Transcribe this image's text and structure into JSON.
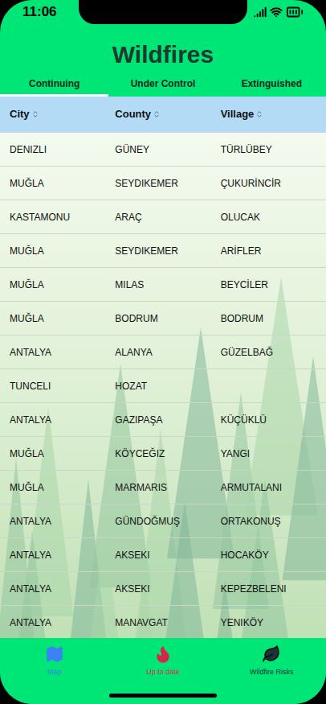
{
  "status_bar": {
    "time": "11:06"
  },
  "title": "Wildfires",
  "tabs": [
    {
      "label": "Continuing",
      "selected": true
    },
    {
      "label": "Under Control",
      "selected": false
    },
    {
      "label": "Extinguished",
      "selected": false
    }
  ],
  "table": {
    "columns": [
      {
        "label": "City"
      },
      {
        "label": "County"
      },
      {
        "label": "Village"
      }
    ],
    "rows": [
      [
        "DENIZLI",
        "GÜNEY",
        "TÜRLÜBEY"
      ],
      [
        "MUĞLA",
        "SEYDIKEMER",
        "ÇUKURİNCİR"
      ],
      [
        "KASTAMONU",
        "ARAÇ",
        "OLUCAK"
      ],
      [
        "MUĞLA",
        "SEYDIKEMER",
        "ARİFLER"
      ],
      [
        "MUĞLA",
        "MILAS",
        "BEYCİLER"
      ],
      [
        "MUĞLA",
        "BODRUM",
        "BODRUM"
      ],
      [
        "ANTALYA",
        "ALANYA",
        "GÜZELBAĞ"
      ],
      [
        "TUNCELI",
        "HOZAT",
        ""
      ],
      [
        "ANTALYA",
        "GAZIPAŞA",
        "KÜÇÜKLÜ"
      ],
      [
        "MUĞLA",
        "KÖYCEĞIZ",
        "YANGI"
      ],
      [
        "MUĞLA",
        "MARMARIS",
        "ARMUTALANI"
      ],
      [
        "ANTALYA",
        "GÜNDOĞMUŞ",
        "ORTAKONUŞ"
      ],
      [
        "ANTALYA",
        "AKSEKI",
        "HOCAKÖY"
      ],
      [
        "ANTALYA",
        "AKSEKI",
        "KEPEZBELENI"
      ],
      [
        "ANTALYA",
        "MANAVGAT",
        "YENIKÖY"
      ]
    ]
  },
  "bottom_nav": [
    {
      "label": "Map",
      "selected": true,
      "color": "#3b82f6"
    },
    {
      "label": "Up to date",
      "selected": false,
      "color": "#e11d48"
    },
    {
      "label": "Wildfire Risks",
      "selected": false,
      "color": "#1f2937"
    }
  ]
}
